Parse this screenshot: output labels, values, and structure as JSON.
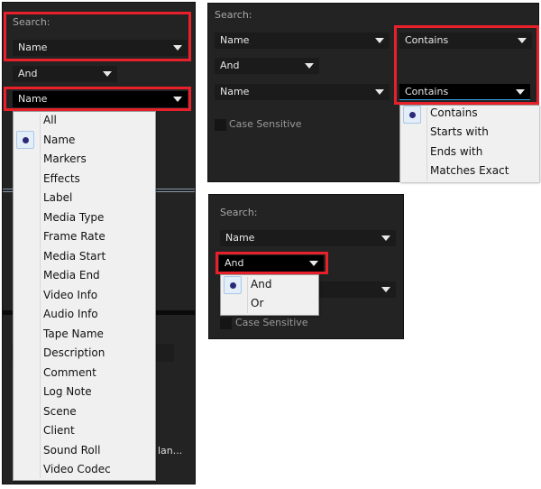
{
  "panel1": {
    "search_label": "Search:",
    "field1": "Name",
    "operator": "And",
    "field2": "Name",
    "menu_items": [
      "All",
      "Name",
      "Markers",
      "Effects",
      "Label",
      "Media Type",
      "Frame Rate",
      "Media Start",
      "Media End",
      "Video Info",
      "Audio Info",
      "Tape Name",
      "Description",
      "Comment",
      "Log Note",
      "Scene",
      "Client",
      "Sound Roll",
      "Video Codec"
    ],
    "selected_item": "Name",
    "bg_truncated_text": "lan..."
  },
  "panel2": {
    "search_label": "Search:",
    "field1": "Name",
    "match1": "Contains",
    "operator": "And",
    "field2": "Name",
    "match2": "Contains",
    "case_sensitive": "Case Sensitive",
    "menu_items": [
      "Contains",
      "Starts with",
      "Ends with",
      "Matches Exact"
    ],
    "selected_item": "Contains"
  },
  "panel3": {
    "search_label": "Search:",
    "field1": "Name",
    "operator": "And",
    "case_sensitive": "Case Sensitive",
    "menu_items": [
      "And",
      "Or"
    ],
    "selected_item": "And"
  },
  "colors": {
    "highlight": "#e8202a",
    "panel_bg": "#232323",
    "menu_bg": "#f0f0f0"
  }
}
